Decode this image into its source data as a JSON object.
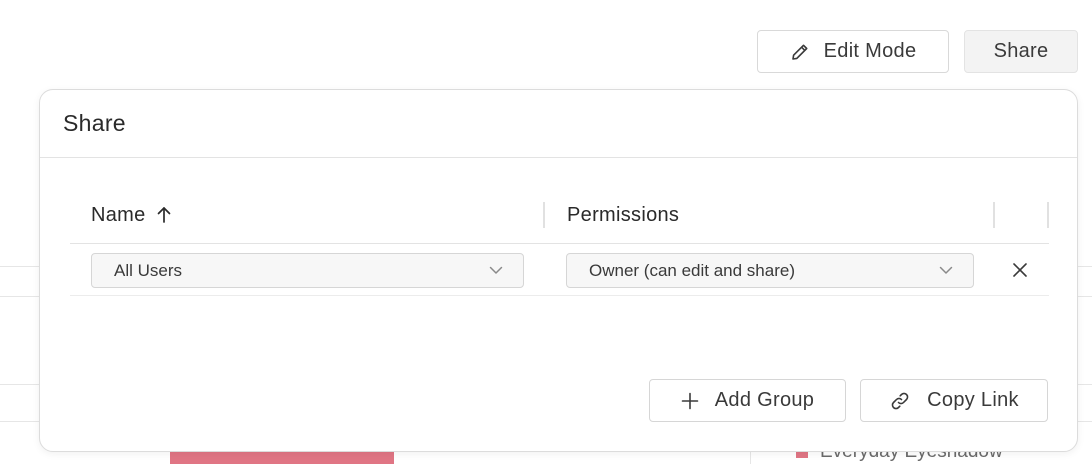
{
  "toolbar": {
    "edit_mode_label": "Edit Mode",
    "share_label": "Share"
  },
  "share_dialog": {
    "title": "Share",
    "columns": {
      "name": "Name",
      "permissions": "Permissions"
    },
    "sort": {
      "column": "Name",
      "direction": "ascending",
      "icon": "arrow-up-icon"
    },
    "rows": [
      {
        "user": "All Users",
        "permission": "Owner (can edit and share)"
      }
    ],
    "add_group_label": "Add Group",
    "copy_link_label": "Copy Link"
  },
  "background": {
    "legend_label": "Everyday Eyeshadow",
    "legend_color": "#e07584"
  },
  "colors": {
    "border": "#d6d6d6",
    "text": "#2b2b2b",
    "accent_bar": "#e07584"
  }
}
